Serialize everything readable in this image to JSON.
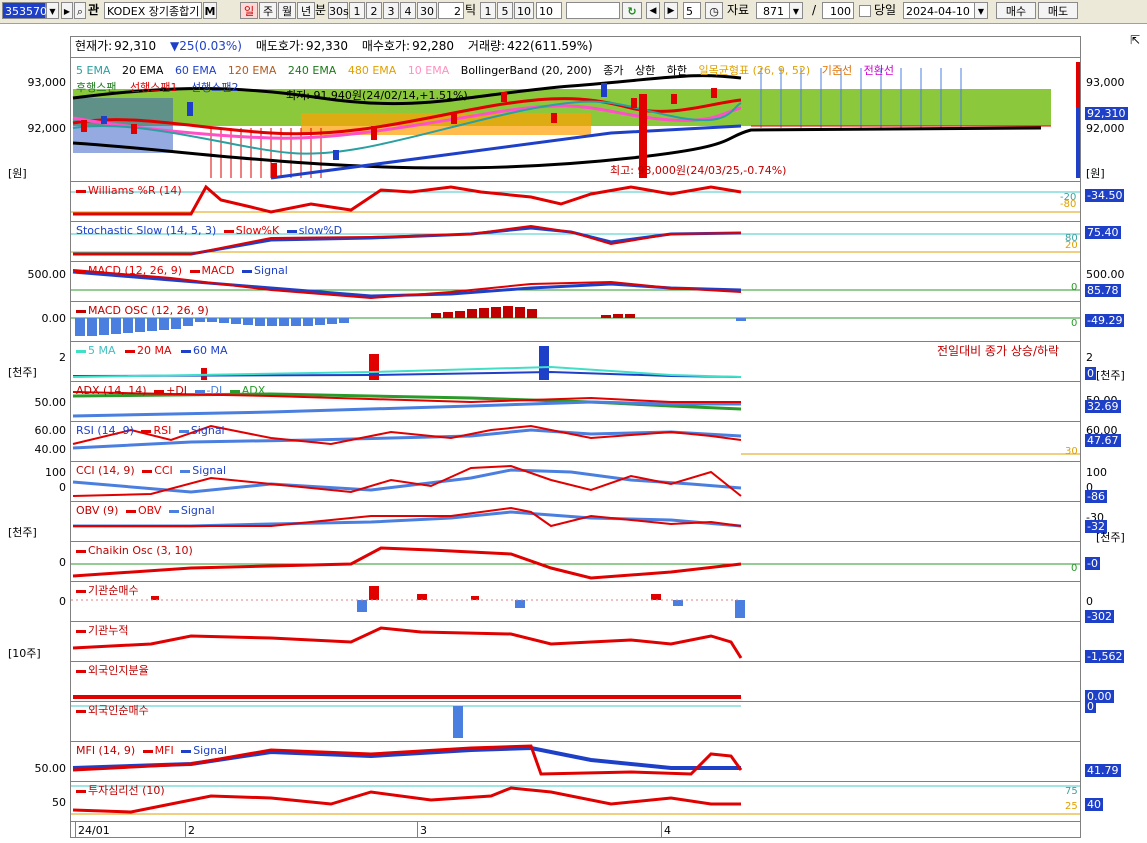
{
  "toolbar": {
    "code": "353570",
    "search_label": "관",
    "name": "KODEX 장기종합기",
    "m_label": "M",
    "periods": [
      "일",
      "주",
      "월",
      "년",
      "분",
      "30s",
      "1",
      "2",
      "3",
      "4",
      "30"
    ],
    "tick_value": "2",
    "tick_label": "틱",
    "tick_options": [
      "1",
      "5",
      "10"
    ],
    "tick_count": "10",
    "step_value": "5",
    "data_label": "자료",
    "data_count": "871",
    "slash": "/",
    "data_total": "100",
    "today_label": "당일",
    "date": "2024-04-10",
    "buy_label": "매수",
    "sell_label": "매도"
  },
  "info": {
    "current_label": "현재가:",
    "current_value": "92,310",
    "change": "▼25(0.03%)",
    "ask_label": "매도호가:",
    "ask_value": "92,330",
    "bid_label": "매수호가:",
    "bid_value": "92,280",
    "volume_label": "거래량:",
    "volume_value": "422(611.59%)"
  },
  "price_legend": [
    "5 EMA",
    "20 EMA",
    "60 EMA",
    "120 EMA",
    "240 EMA",
    "480 EMA",
    "10 EMA",
    "BollingerBand (20, 200)",
    "종가",
    "상한",
    "하한",
    "일목균형표 (26, 9, 52)",
    "기준선",
    "전환선"
  ],
  "price_legend2": [
    "후행스팬",
    "선행스팬1",
    "선행스팬2"
  ],
  "price_labels": {
    "annot_low": "최저: 91,940원(24/02/14,+1.51%)",
    "annot_high": "최고: 93,000원(24/03/25,-0.74%)",
    "unit": "[원]",
    "y_93000": "93,000",
    "y_92000": "92,000",
    "current_box": "92,310"
  },
  "panels": {
    "williams": {
      "legend": "Williams %R (14)",
      "r1": "-20",
      "r2": "-80",
      "value": "-34.50"
    },
    "stoch": {
      "legend": "Stochastic Slow (14, 5, 3)",
      "k": "Slow%K",
      "d": "slow%D",
      "r1": "80",
      "r2": "20",
      "value": "75.40"
    },
    "macd": {
      "legend": "MACD (12, 26, 9)",
      "a": "MACD",
      "b": "Signal",
      "y1": "500.00",
      "zero": "0",
      "value": "85.78"
    },
    "macdosc": {
      "legend": "MACD OSC (12, 26, 9)",
      "y1": "0.00",
      "zero": "0",
      "value": "-49.29"
    },
    "volume": {
      "legend_a": "5 MA",
      "legend_b": "20 MA",
      "legend_c": "60 MA",
      "note": "전일대비 종가 상승/하락",
      "y1": "2",
      "unit": "[천주]",
      "r1": "2",
      "value": "0",
      "unit_r": "[천주]"
    },
    "adx": {
      "legend": "ADX (14, 14)",
      "a": "+DI",
      "b": "-DI",
      "c": "ADX",
      "y1": "50.00",
      "r1": "50.00",
      "value": "32.69"
    },
    "rsi": {
      "legend": "RSI (14, 9)",
      "a": "RSI",
      "b": "Signal",
      "y1": "60.00",
      "y2": "40.00",
      "r1": "60.00",
      "r2": "30",
      "value": "47.67"
    },
    "cci": {
      "legend": "CCI (14, 9)",
      "a": "CCI",
      "b": "Signal",
      "y1": "100",
      "y2": "0",
      "r1": "100",
      "r2": "0",
      "value": "-86"
    },
    "obv": {
      "legend": "OBV (9)",
      "a": "OBV",
      "b": "Signal",
      "unit": "[천주]",
      "r1": "-30",
      "value": "-32",
      "unit_r": "[천주]"
    },
    "chaikin": {
      "legend": "Chaikin Osc (3, 10)",
      "y1": "0",
      "r1": "0",
      "value": "-0"
    },
    "inst": {
      "legend": "기관순매수",
      "y1": "0",
      "r1": "0",
      "value": "-302"
    },
    "instcum": {
      "legend": "기관누적",
      "unit": "[10주]",
      "value": "-1,562"
    },
    "foreignratio": {
      "legend": "외국인지분율",
      "value": "0.00"
    },
    "foreignnet": {
      "legend": "외국인순매수",
      "value": "0"
    },
    "mfi": {
      "legend": "MFI (14, 9)",
      "a": "MFI",
      "b": "Signal",
      "y1": "50.00",
      "value": "41.79"
    },
    "psy": {
      "legend": "투자심리선 (10)",
      "y1": "50",
      "r1": "75",
      "r2": "25",
      "value": "40"
    }
  },
  "xaxis": [
    "24/01",
    "2",
    "3",
    "4"
  ],
  "colors": {
    "red": "#e00000",
    "blue": "#1e40c8",
    "light_blue": "#4a7fe0",
    "green": "#2a9a2a",
    "brown": "#b05a20"
  }
}
